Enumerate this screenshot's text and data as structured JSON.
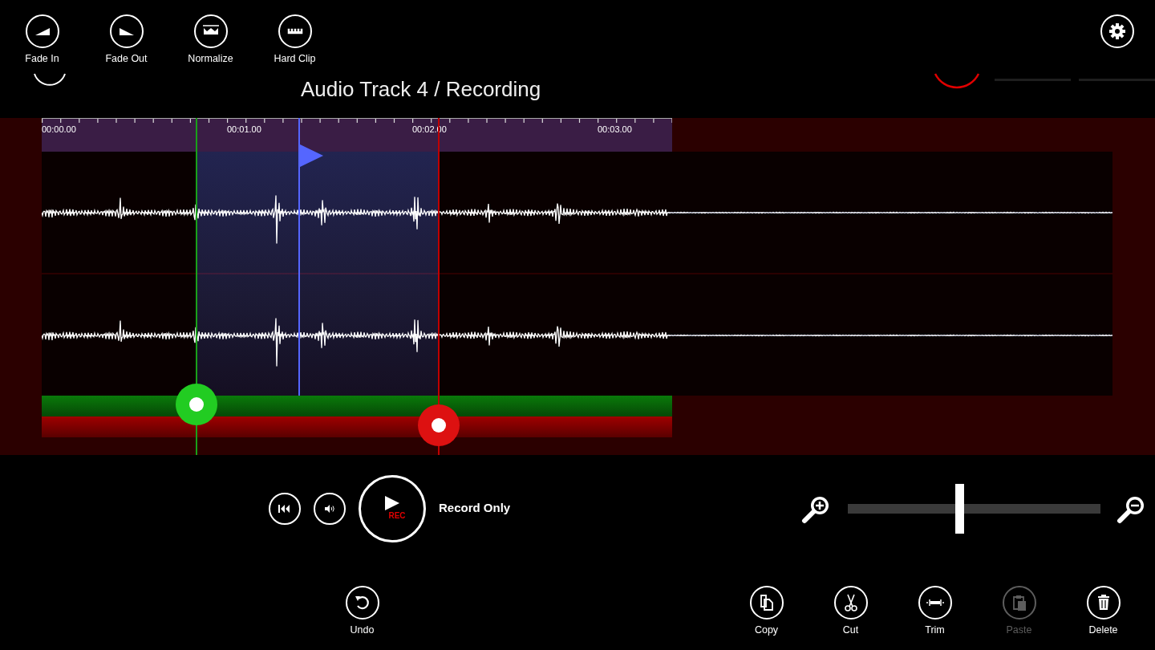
{
  "top_bar": {
    "tools": [
      {
        "kind": "fade_in",
        "label": "Fade In"
      },
      {
        "kind": "fade_out",
        "label": "Fade Out"
      },
      {
        "kind": "normalize",
        "label": "Normalize"
      },
      {
        "kind": "hard_clip",
        "label": "Hard Clip"
      }
    ]
  },
  "title": "Audio Track 4 / Recording",
  "timeline": {
    "ticks": [
      "00:00.00",
      "00:01.00",
      "00:02.00",
      "00:03.00"
    ],
    "playhead": {
      "level": 0.408
    }
  },
  "transport": {
    "play_badge": "REC",
    "mode": "Record Only",
    "zoom": {
      "level": 0.44
    }
  },
  "bottom_bar": {
    "left": [
      {
        "kind": "undo",
        "label": "Undo",
        "disabled": false
      }
    ],
    "right": [
      {
        "kind": "copy",
        "label": "Copy",
        "disabled": false
      },
      {
        "kind": "cut",
        "label": "Cut",
        "disabled": false
      },
      {
        "kind": "trim",
        "label": "Trim",
        "disabled": false
      },
      {
        "kind": "paste",
        "label": "Paste",
        "disabled": true
      },
      {
        "kind": "delete",
        "label": "Delete",
        "disabled": false
      }
    ]
  }
}
